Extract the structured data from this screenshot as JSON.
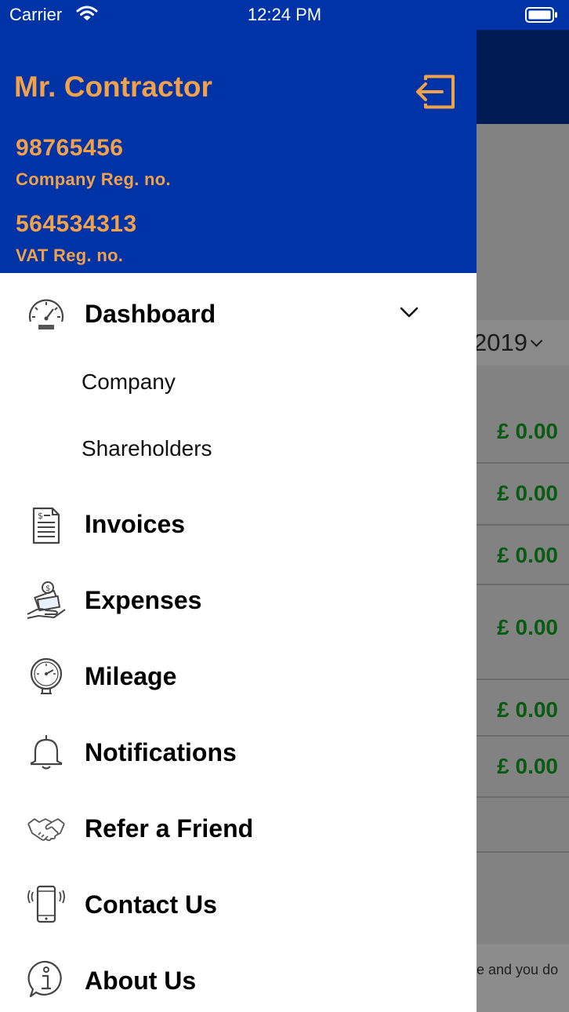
{
  "status_bar": {
    "carrier": "Carrier",
    "time": "12:24 PM"
  },
  "drawer": {
    "user_name": "Mr. Contractor",
    "company_reg_value": "98765456",
    "company_reg_label": "Company Reg. no.",
    "vat_reg_value": "564534313",
    "vat_reg_label": "VAT Reg. no.",
    "menu": [
      {
        "label": "Dashboard",
        "icon": "speedometer-icon",
        "expanded": true,
        "sub_items": [
          {
            "label": "Company"
          },
          {
            "label": "Shareholders"
          }
        ]
      },
      {
        "label": "Invoices",
        "icon": "invoice-document-icon"
      },
      {
        "label": "Expenses",
        "icon": "money-hand-icon"
      },
      {
        "label": "Mileage",
        "icon": "gauge-icon"
      },
      {
        "label": "Notifications",
        "icon": "bell-icon"
      },
      {
        "label": "Refer a Friend",
        "icon": "handshake-icon"
      },
      {
        "label": "Contact Us",
        "icon": "phone-ringing-icon"
      },
      {
        "label": "About Us",
        "icon": "info-icon"
      }
    ]
  },
  "background": {
    "year": "2019",
    "amounts": [
      "£ 0.00",
      "£ 0.00",
      "£ 0.00",
      "£ 0.00",
      "£ 0.00",
      "£ 0.00"
    ],
    "footer_text": "e and you do"
  },
  "colors": {
    "primary": "#0033a6",
    "accent": "#f1a14a",
    "navbar_dark": "#011b55",
    "amount_green": "#0a5b12"
  }
}
